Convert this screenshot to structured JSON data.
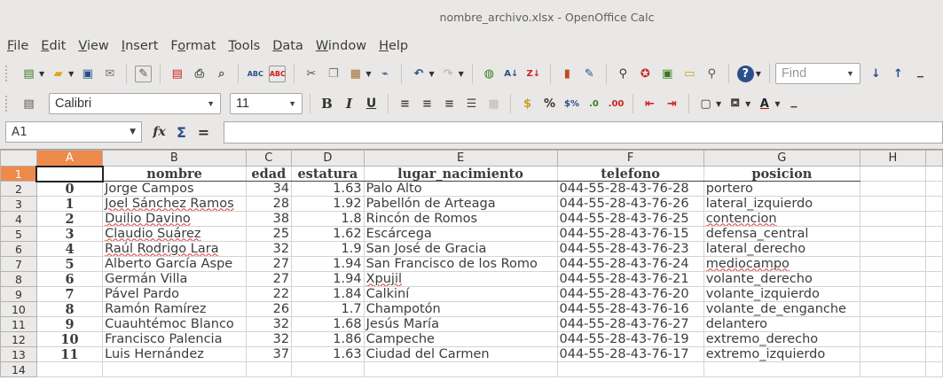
{
  "window": {
    "title": "nombre_archivo.xlsx - OpenOffice Calc"
  },
  "menu": [
    {
      "pre": "",
      "u": "F",
      "post": "ile"
    },
    {
      "pre": "",
      "u": "E",
      "post": "dit"
    },
    {
      "pre": "",
      "u": "V",
      "post": "iew"
    },
    {
      "pre": "",
      "u": "I",
      "post": "nsert"
    },
    {
      "pre": "F",
      "u": "o",
      "post": "rmat"
    },
    {
      "pre": "",
      "u": "T",
      "post": "ools"
    },
    {
      "pre": "",
      "u": "D",
      "post": "ata"
    },
    {
      "pre": "",
      "u": "W",
      "post": "indow"
    },
    {
      "pre": "",
      "u": "H",
      "post": "elp"
    }
  ],
  "toolbar": {
    "find_placeholder": "Find"
  },
  "format": {
    "font_name": "Calibri",
    "font_size": "11",
    "bold": "B",
    "italic": "I",
    "underline": "U"
  },
  "formula": {
    "cell_ref": "A1",
    "fx": "fx",
    "sigma": "Σ",
    "equals": "="
  },
  "sheet": {
    "columns": [
      "A",
      "B",
      "C",
      "D",
      "E",
      "F",
      "G",
      "H"
    ],
    "header": [
      "",
      "nombre",
      "edad",
      "estatura",
      "lugar_nacimiento",
      "telefono",
      "posicion"
    ],
    "rows": [
      [
        "0",
        "Jorge Campos",
        "34",
        "1.63",
        "Palo Alto",
        "044-55-28-43-76-28",
        "portero"
      ],
      [
        "1",
        "Joel Sánchez Ramos",
        "28",
        "1.92",
        "Pabellón de Arteaga",
        "044-55-28-43-76-26",
        "lateral_izquierdo"
      ],
      [
        "2",
        "Duilio Davino",
        "38",
        "1.8",
        "Rincón de Romos",
        "044-55-28-43-76-25",
        "contencion"
      ],
      [
        "3",
        "Claudio Suárez",
        "25",
        "1.62",
        "Escárcega",
        "044-55-28-43-76-15",
        "defensa_central"
      ],
      [
        "4",
        "Raúl Rodrigo Lara",
        "32",
        "1.9",
        "San José de Gracia",
        "044-55-28-43-76-23",
        "lateral_derecho"
      ],
      [
        "5",
        "Alberto García Aspe",
        "27",
        "1.94",
        "San Francisco de los Romo",
        "044-55-28-43-76-24",
        "mediocampo"
      ],
      [
        "6",
        "Germán Villa",
        "27",
        "1.94",
        "Xpujil",
        "044-55-28-43-76-21",
        "volante_derecho"
      ],
      [
        "7",
        "Pável Pardo",
        "22",
        "1.84",
        "Calkiní",
        "044-55-28-43-76-20",
        "volante_izquierdo"
      ],
      [
        "8",
        "Ramón Ramírez",
        "26",
        "1.7",
        "Champotón",
        "044-55-28-43-76-16",
        "volante_de_enganche"
      ],
      [
        "9",
        "Cuauhtémoc Blanco",
        "32",
        "1.68",
        "Jesús María",
        "044-55-28-43-76-27",
        "delantero"
      ],
      [
        "10",
        "Francisco Palencia",
        "32",
        "1.86",
        "Campeche",
        "044-55-28-43-76-19",
        "extremo_derecho"
      ],
      [
        "11",
        "Luis Hernández",
        "37",
        "1.63",
        "Ciudad del Carmen",
        "044-55-28-43-76-17",
        "extremo_izquierdo"
      ]
    ],
    "row_numbers": [
      "1",
      "2",
      "3",
      "4",
      "5",
      "6",
      "7",
      "8",
      "9",
      "10",
      "11",
      "12",
      "13",
      "14"
    ]
  },
  "colors": {
    "selection": "#ed8a4c"
  }
}
